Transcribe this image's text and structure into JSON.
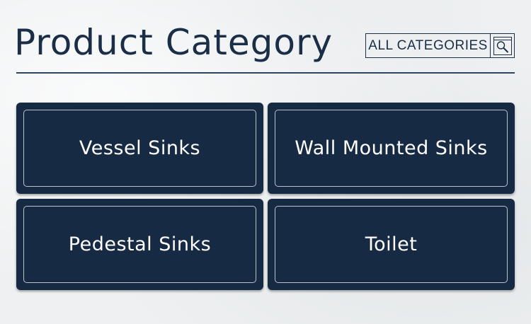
{
  "header": {
    "title": "Product Category",
    "all_categories_label": "ALL CATEGORIES",
    "search_icon": "search-magnifier-icon"
  },
  "categories": [
    {
      "label": "Vessel Sinks"
    },
    {
      "label": "Wall Mounted Sinks"
    },
    {
      "label": "Pedestal Sinks"
    },
    {
      "label": "Toilet"
    }
  ],
  "colors": {
    "primary": "#172a43",
    "text_dark": "#1a2e47",
    "background": "#eef0f1",
    "tile_text": "#ffffff"
  }
}
